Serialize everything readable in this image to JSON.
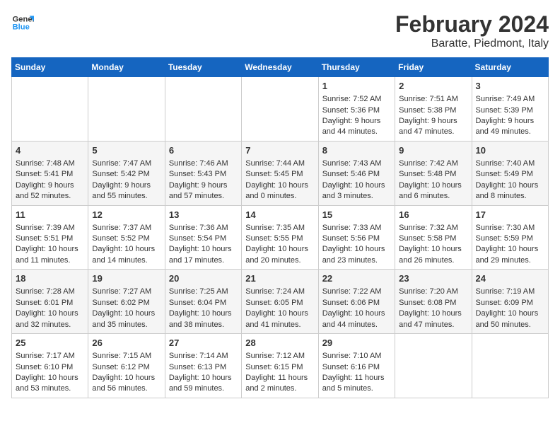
{
  "header": {
    "logo_line1": "General",
    "logo_line2": "Blue",
    "title": "February 2024",
    "subtitle": "Baratte, Piedmont, Italy"
  },
  "days_of_week": [
    "Sunday",
    "Monday",
    "Tuesday",
    "Wednesday",
    "Thursday",
    "Friday",
    "Saturday"
  ],
  "weeks": [
    {
      "cells": [
        {
          "day": null,
          "content": ""
        },
        {
          "day": null,
          "content": ""
        },
        {
          "day": null,
          "content": ""
        },
        {
          "day": null,
          "content": ""
        },
        {
          "day": "1",
          "sunrise": "Sunrise: 7:52 AM",
          "sunset": "Sunset: 5:36 PM",
          "daylight": "Daylight: 9 hours and 44 minutes."
        },
        {
          "day": "2",
          "sunrise": "Sunrise: 7:51 AM",
          "sunset": "Sunset: 5:38 PM",
          "daylight": "Daylight: 9 hours and 47 minutes."
        },
        {
          "day": "3",
          "sunrise": "Sunrise: 7:49 AM",
          "sunset": "Sunset: 5:39 PM",
          "daylight": "Daylight: 9 hours and 49 minutes."
        }
      ]
    },
    {
      "cells": [
        {
          "day": "4",
          "sunrise": "Sunrise: 7:48 AM",
          "sunset": "Sunset: 5:41 PM",
          "daylight": "Daylight: 9 hours and 52 minutes."
        },
        {
          "day": "5",
          "sunrise": "Sunrise: 7:47 AM",
          "sunset": "Sunset: 5:42 PM",
          "daylight": "Daylight: 9 hours and 55 minutes."
        },
        {
          "day": "6",
          "sunrise": "Sunrise: 7:46 AM",
          "sunset": "Sunset: 5:43 PM",
          "daylight": "Daylight: 9 hours and 57 minutes."
        },
        {
          "day": "7",
          "sunrise": "Sunrise: 7:44 AM",
          "sunset": "Sunset: 5:45 PM",
          "daylight": "Daylight: 10 hours and 0 minutes."
        },
        {
          "day": "8",
          "sunrise": "Sunrise: 7:43 AM",
          "sunset": "Sunset: 5:46 PM",
          "daylight": "Daylight: 10 hours and 3 minutes."
        },
        {
          "day": "9",
          "sunrise": "Sunrise: 7:42 AM",
          "sunset": "Sunset: 5:48 PM",
          "daylight": "Daylight: 10 hours and 6 minutes."
        },
        {
          "day": "10",
          "sunrise": "Sunrise: 7:40 AM",
          "sunset": "Sunset: 5:49 PM",
          "daylight": "Daylight: 10 hours and 8 minutes."
        }
      ]
    },
    {
      "cells": [
        {
          "day": "11",
          "sunrise": "Sunrise: 7:39 AM",
          "sunset": "Sunset: 5:51 PM",
          "daylight": "Daylight: 10 hours and 11 minutes."
        },
        {
          "day": "12",
          "sunrise": "Sunrise: 7:37 AM",
          "sunset": "Sunset: 5:52 PM",
          "daylight": "Daylight: 10 hours and 14 minutes."
        },
        {
          "day": "13",
          "sunrise": "Sunrise: 7:36 AM",
          "sunset": "Sunset: 5:54 PM",
          "daylight": "Daylight: 10 hours and 17 minutes."
        },
        {
          "day": "14",
          "sunrise": "Sunrise: 7:35 AM",
          "sunset": "Sunset: 5:55 PM",
          "daylight": "Daylight: 10 hours and 20 minutes."
        },
        {
          "day": "15",
          "sunrise": "Sunrise: 7:33 AM",
          "sunset": "Sunset: 5:56 PM",
          "daylight": "Daylight: 10 hours and 23 minutes."
        },
        {
          "day": "16",
          "sunrise": "Sunrise: 7:32 AM",
          "sunset": "Sunset: 5:58 PM",
          "daylight": "Daylight: 10 hours and 26 minutes."
        },
        {
          "day": "17",
          "sunrise": "Sunrise: 7:30 AM",
          "sunset": "Sunset: 5:59 PM",
          "daylight": "Daylight: 10 hours and 29 minutes."
        }
      ]
    },
    {
      "cells": [
        {
          "day": "18",
          "sunrise": "Sunrise: 7:28 AM",
          "sunset": "Sunset: 6:01 PM",
          "daylight": "Daylight: 10 hours and 32 minutes."
        },
        {
          "day": "19",
          "sunrise": "Sunrise: 7:27 AM",
          "sunset": "Sunset: 6:02 PM",
          "daylight": "Daylight: 10 hours and 35 minutes."
        },
        {
          "day": "20",
          "sunrise": "Sunrise: 7:25 AM",
          "sunset": "Sunset: 6:04 PM",
          "daylight": "Daylight: 10 hours and 38 minutes."
        },
        {
          "day": "21",
          "sunrise": "Sunrise: 7:24 AM",
          "sunset": "Sunset: 6:05 PM",
          "daylight": "Daylight: 10 hours and 41 minutes."
        },
        {
          "day": "22",
          "sunrise": "Sunrise: 7:22 AM",
          "sunset": "Sunset: 6:06 PM",
          "daylight": "Daylight: 10 hours and 44 minutes."
        },
        {
          "day": "23",
          "sunrise": "Sunrise: 7:20 AM",
          "sunset": "Sunset: 6:08 PM",
          "daylight": "Daylight: 10 hours and 47 minutes."
        },
        {
          "day": "24",
          "sunrise": "Sunrise: 7:19 AM",
          "sunset": "Sunset: 6:09 PM",
          "daylight": "Daylight: 10 hours and 50 minutes."
        }
      ]
    },
    {
      "cells": [
        {
          "day": "25",
          "sunrise": "Sunrise: 7:17 AM",
          "sunset": "Sunset: 6:10 PM",
          "daylight": "Daylight: 10 hours and 53 minutes."
        },
        {
          "day": "26",
          "sunrise": "Sunrise: 7:15 AM",
          "sunset": "Sunset: 6:12 PM",
          "daylight": "Daylight: 10 hours and 56 minutes."
        },
        {
          "day": "27",
          "sunrise": "Sunrise: 7:14 AM",
          "sunset": "Sunset: 6:13 PM",
          "daylight": "Daylight: 10 hours and 59 minutes."
        },
        {
          "day": "28",
          "sunrise": "Sunrise: 7:12 AM",
          "sunset": "Sunset: 6:15 PM",
          "daylight": "Daylight: 11 hours and 2 minutes."
        },
        {
          "day": "29",
          "sunrise": "Sunrise: 7:10 AM",
          "sunset": "Sunset: 6:16 PM",
          "daylight": "Daylight: 11 hours and 5 minutes."
        },
        {
          "day": null,
          "content": ""
        },
        {
          "day": null,
          "content": ""
        }
      ]
    }
  ]
}
